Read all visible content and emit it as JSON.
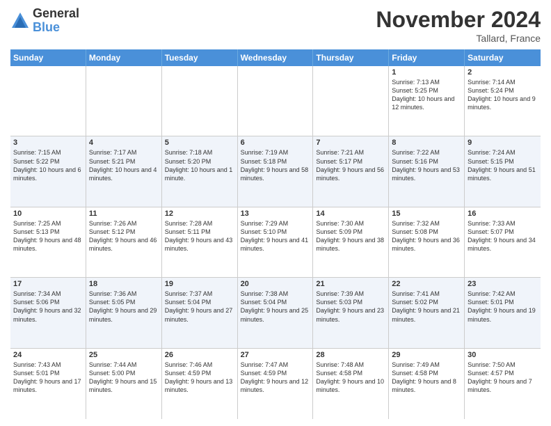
{
  "logo": {
    "general": "General",
    "blue": "Blue"
  },
  "title": "November 2024",
  "location": "Tallard, France",
  "days": [
    "Sunday",
    "Monday",
    "Tuesday",
    "Wednesday",
    "Thursday",
    "Friday",
    "Saturday"
  ],
  "rows": [
    [
      {
        "day": "",
        "text": ""
      },
      {
        "day": "",
        "text": ""
      },
      {
        "day": "",
        "text": ""
      },
      {
        "day": "",
        "text": ""
      },
      {
        "day": "",
        "text": ""
      },
      {
        "day": "1",
        "text": "Sunrise: 7:13 AM\nSunset: 5:25 PM\nDaylight: 10 hours and 12 minutes."
      },
      {
        "day": "2",
        "text": "Sunrise: 7:14 AM\nSunset: 5:24 PM\nDaylight: 10 hours and 9 minutes."
      }
    ],
    [
      {
        "day": "3",
        "text": "Sunrise: 7:15 AM\nSunset: 5:22 PM\nDaylight: 10 hours and 6 minutes."
      },
      {
        "day": "4",
        "text": "Sunrise: 7:17 AM\nSunset: 5:21 PM\nDaylight: 10 hours and 4 minutes."
      },
      {
        "day": "5",
        "text": "Sunrise: 7:18 AM\nSunset: 5:20 PM\nDaylight: 10 hours and 1 minute."
      },
      {
        "day": "6",
        "text": "Sunrise: 7:19 AM\nSunset: 5:18 PM\nDaylight: 9 hours and 58 minutes."
      },
      {
        "day": "7",
        "text": "Sunrise: 7:21 AM\nSunset: 5:17 PM\nDaylight: 9 hours and 56 minutes."
      },
      {
        "day": "8",
        "text": "Sunrise: 7:22 AM\nSunset: 5:16 PM\nDaylight: 9 hours and 53 minutes."
      },
      {
        "day": "9",
        "text": "Sunrise: 7:24 AM\nSunset: 5:15 PM\nDaylight: 9 hours and 51 minutes."
      }
    ],
    [
      {
        "day": "10",
        "text": "Sunrise: 7:25 AM\nSunset: 5:13 PM\nDaylight: 9 hours and 48 minutes."
      },
      {
        "day": "11",
        "text": "Sunrise: 7:26 AM\nSunset: 5:12 PM\nDaylight: 9 hours and 46 minutes."
      },
      {
        "day": "12",
        "text": "Sunrise: 7:28 AM\nSunset: 5:11 PM\nDaylight: 9 hours and 43 minutes."
      },
      {
        "day": "13",
        "text": "Sunrise: 7:29 AM\nSunset: 5:10 PM\nDaylight: 9 hours and 41 minutes."
      },
      {
        "day": "14",
        "text": "Sunrise: 7:30 AM\nSunset: 5:09 PM\nDaylight: 9 hours and 38 minutes."
      },
      {
        "day": "15",
        "text": "Sunrise: 7:32 AM\nSunset: 5:08 PM\nDaylight: 9 hours and 36 minutes."
      },
      {
        "day": "16",
        "text": "Sunrise: 7:33 AM\nSunset: 5:07 PM\nDaylight: 9 hours and 34 minutes."
      }
    ],
    [
      {
        "day": "17",
        "text": "Sunrise: 7:34 AM\nSunset: 5:06 PM\nDaylight: 9 hours and 32 minutes."
      },
      {
        "day": "18",
        "text": "Sunrise: 7:36 AM\nSunset: 5:05 PM\nDaylight: 9 hours and 29 minutes."
      },
      {
        "day": "19",
        "text": "Sunrise: 7:37 AM\nSunset: 5:04 PM\nDaylight: 9 hours and 27 minutes."
      },
      {
        "day": "20",
        "text": "Sunrise: 7:38 AM\nSunset: 5:04 PM\nDaylight: 9 hours and 25 minutes."
      },
      {
        "day": "21",
        "text": "Sunrise: 7:39 AM\nSunset: 5:03 PM\nDaylight: 9 hours and 23 minutes."
      },
      {
        "day": "22",
        "text": "Sunrise: 7:41 AM\nSunset: 5:02 PM\nDaylight: 9 hours and 21 minutes."
      },
      {
        "day": "23",
        "text": "Sunrise: 7:42 AM\nSunset: 5:01 PM\nDaylight: 9 hours and 19 minutes."
      }
    ],
    [
      {
        "day": "24",
        "text": "Sunrise: 7:43 AM\nSunset: 5:01 PM\nDaylight: 9 hours and 17 minutes."
      },
      {
        "day": "25",
        "text": "Sunrise: 7:44 AM\nSunset: 5:00 PM\nDaylight: 9 hours and 15 minutes."
      },
      {
        "day": "26",
        "text": "Sunrise: 7:46 AM\nSunset: 4:59 PM\nDaylight: 9 hours and 13 minutes."
      },
      {
        "day": "27",
        "text": "Sunrise: 7:47 AM\nSunset: 4:59 PM\nDaylight: 9 hours and 12 minutes."
      },
      {
        "day": "28",
        "text": "Sunrise: 7:48 AM\nSunset: 4:58 PM\nDaylight: 9 hours and 10 minutes."
      },
      {
        "day": "29",
        "text": "Sunrise: 7:49 AM\nSunset: 4:58 PM\nDaylight: 9 hours and 8 minutes."
      },
      {
        "day": "30",
        "text": "Sunrise: 7:50 AM\nSunset: 4:57 PM\nDaylight: 9 hours and 7 minutes."
      }
    ]
  ]
}
